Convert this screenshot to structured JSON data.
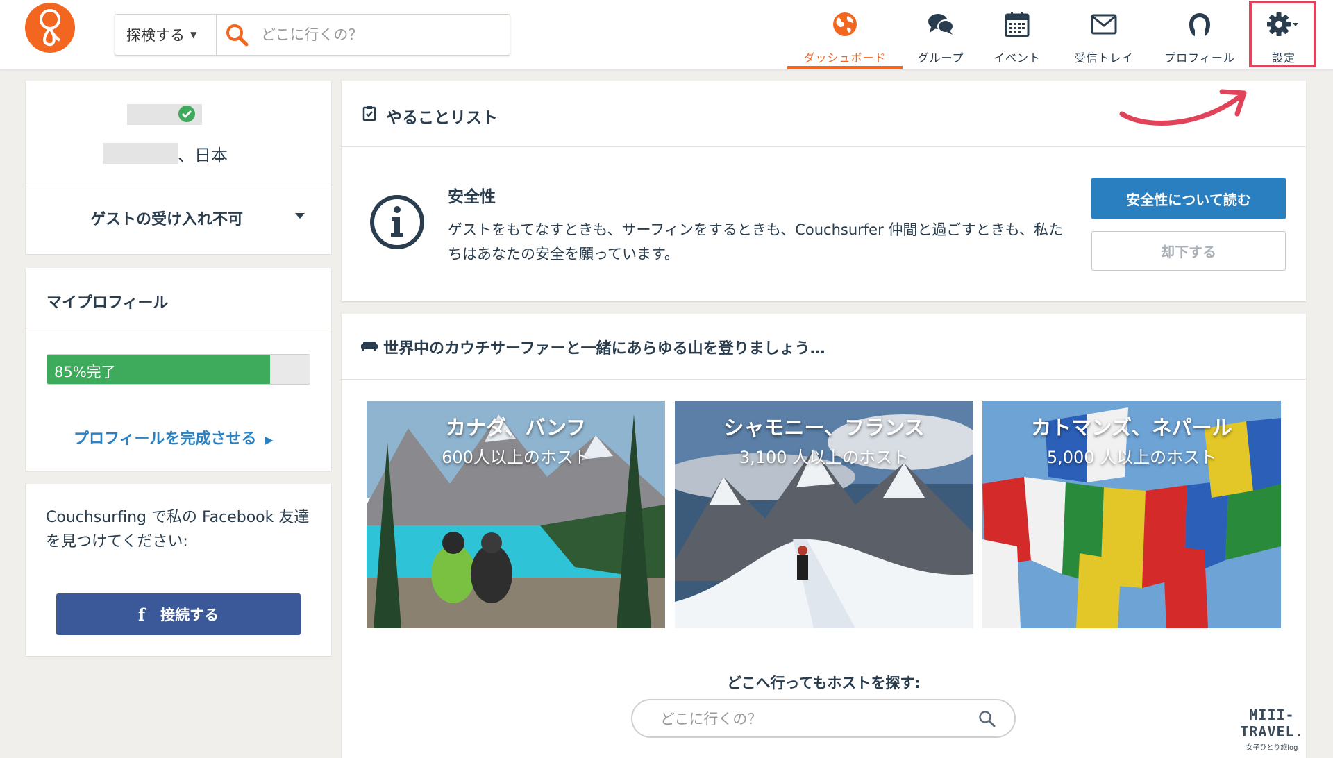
{
  "header": {
    "explore_label": "探検する",
    "search_placeholder": "どこに行くの？",
    "nav": [
      {
        "label": "ダッシュボード",
        "icon": "globe-icon",
        "active": true
      },
      {
        "label": "グループ",
        "icon": "chat-bubbles-icon",
        "active": false
      },
      {
        "label": "イベント",
        "icon": "calendar-icon",
        "active": false
      },
      {
        "label": "受信トレイ",
        "icon": "envelope-icon",
        "active": false
      },
      {
        "label": "プロフィール",
        "icon": "user-icon",
        "active": false
      },
      {
        "label": "設定",
        "icon": "gear-icon",
        "active": false
      }
    ]
  },
  "profile": {
    "country": "、日本",
    "host_status": "ゲストの受け入れ不可"
  },
  "my_profile": {
    "title": "マイプロフィール",
    "progress_label": "85%完了",
    "progress_value": 0.85,
    "complete_link": "プロフィールを完成させる"
  },
  "facebook": {
    "text": "Couchsurfing で私の Facebook 友達を見つけてください:",
    "button_label": "接続する"
  },
  "todo": {
    "title": "やることリスト",
    "safety_title": "安全性",
    "safety_desc": "ゲストをもてなすときも、サーフィンをするときも、Couchsurfer 仲間と過ごすときも、私たちはあなたの安全を願っています。",
    "read_button": "安全性について読む",
    "dismiss_button": "却下する"
  },
  "mountains": {
    "title": "世界中のカウチサーファーと一緒にあらゆる山を登りましょう…",
    "destinations": [
      {
        "city": "カナダ、バンフ",
        "hosts": "600人以上のホスト"
      },
      {
        "city": "シャモニー、フランス",
        "hosts": "3,100 人以上のホスト"
      },
      {
        "city": "カトマンズ、ネパール",
        "hosts": "5,000 人以上のホスト"
      }
    ],
    "find_title": "どこへ行ってもホストを探す:",
    "search_placeholder": "どこに行くの？"
  },
  "watermark": {
    "brand": "MIII-TRAVEL.",
    "tagline": "女子ひとり旅log"
  },
  "colors": {
    "brand_orange": "#f2661f",
    "link_blue": "#2a82c4",
    "progress_green": "#3daa5c",
    "facebook_blue": "#3b5998",
    "highlight_red": "#e0435a"
  }
}
